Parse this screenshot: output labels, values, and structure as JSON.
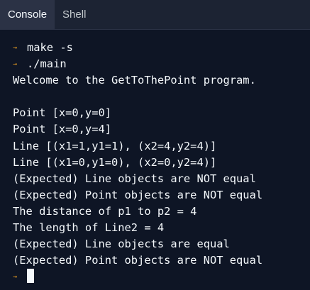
{
  "tabs": [
    {
      "label": "Console",
      "active": true
    },
    {
      "label": "Shell",
      "active": false
    }
  ],
  "colors": {
    "background": "#0e1525",
    "tabbar": "#1c2333",
    "text": "#f5f9fc",
    "prompt": "#f5a623"
  },
  "terminal": {
    "prompt_icon": "chevron-right-icon",
    "commands": [
      "make -s",
      "./main"
    ],
    "output": [
      "Welcome to the GetToThePoint program.",
      "",
      "Point [x=0,y=0]",
      "Point [x=0,y=4]",
      "Line [(x1=1,y1=1), (x2=4,y2=4)]",
      "Line [(x1=0,y1=0), (x2=0,y2=4)]",
      "(Expected) Line objects are NOT equal",
      "(Expected) Point objects are NOT equal",
      "The distance of p1 to p2 = 4",
      "The length of Line2 = 4",
      "(Expected) Line objects are equal",
      "(Expected) Point objects are NOT equal"
    ]
  }
}
